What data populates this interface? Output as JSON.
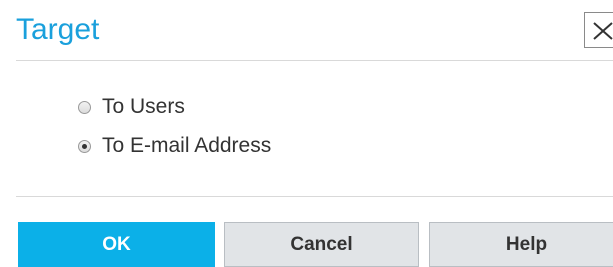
{
  "dialog": {
    "title": "Target",
    "close_icon": "close-x-icon"
  },
  "options": [
    {
      "label": "To Users",
      "selected": false
    },
    {
      "label": "To E-mail Address",
      "selected": true
    }
  ],
  "buttons": {
    "ok_label": "OK",
    "cancel_label": "Cancel",
    "help_label": "Help"
  },
  "colors": {
    "title": "#1aa0dc",
    "primary_button": "#0bb0e8",
    "secondary_button": "#e1e4e7",
    "text": "#333333"
  }
}
